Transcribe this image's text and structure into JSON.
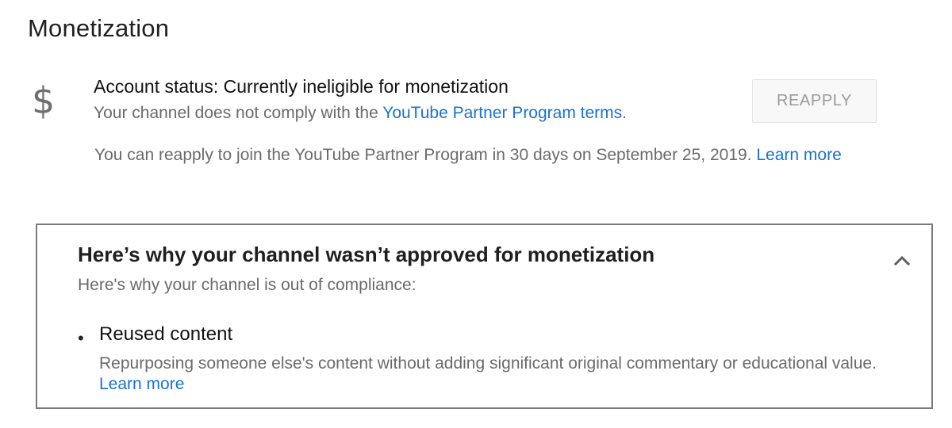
{
  "page": {
    "title": "Monetization"
  },
  "account": {
    "icon": "dollar-icon",
    "icon_glyph": "$",
    "status_title": "Account status: Currently ineligible for monetization",
    "status_desc_prefix": "Your channel does not comply with the ",
    "status_desc_link": "YouTube Partner Program terms",
    "status_desc_suffix": ".",
    "reapply_button_label": "REAPPLY",
    "reapply_note_text": "You can reapply to join the YouTube Partner Program in 30 days on September 25, 2019.",
    "reapply_note_link": "Learn more"
  },
  "reason_panel": {
    "title": "Here’s why your channel wasn’t approved for monetization",
    "subtitle": "Here's why your channel is out of compliance:",
    "collapse_icon": "chevron-up-icon",
    "items": [
      {
        "bullet": "•",
        "name": "Reused content",
        "description": "Repurposing someone else's content without adding significant original commentary or educational value.",
        "link": "Learn more"
      }
    ]
  },
  "colors": {
    "link": "#1a73c9",
    "text_primary": "#111111",
    "text_secondary": "#6a6a6a",
    "icon_gray": "#6f6f6f",
    "button_disabled_text": "#9a9a9a",
    "card_border": "#7a7a7a"
  }
}
